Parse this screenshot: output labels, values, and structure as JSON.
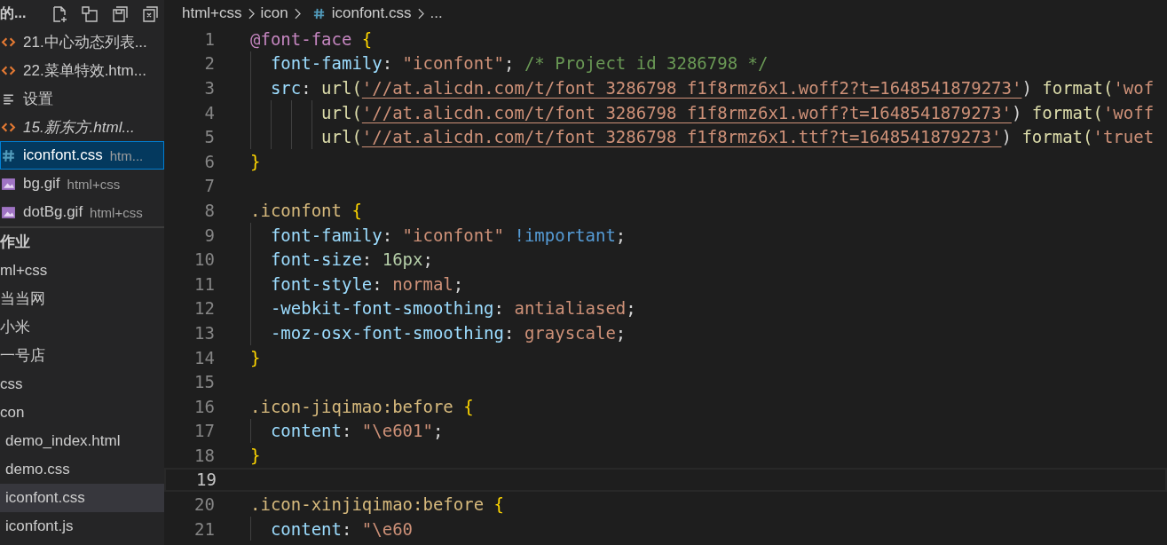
{
  "sidebar": {
    "open_editors": {
      "title": "的...",
      "items": [
        {
          "kind": "html",
          "label": "21.中心动态列表...",
          "italic": false,
          "selected": false
        },
        {
          "kind": "html",
          "label": "22.菜单特效.htm...",
          "italic": false,
          "selected": false
        },
        {
          "kind": "settings",
          "label": "设置",
          "italic": false,
          "selected": false
        },
        {
          "kind": "html",
          "label": "15.新东方.html...",
          "italic": true,
          "selected": false
        },
        {
          "kind": "css",
          "label": "iconfont.css",
          "description": "htm...",
          "italic": false,
          "selected": true
        },
        {
          "kind": "image",
          "label": "bg.gif",
          "description": "html+css",
          "italic": false,
          "selected": false
        },
        {
          "kind": "image",
          "label": "dotBg.gif",
          "description": "html+css",
          "italic": false,
          "selected": false
        }
      ]
    },
    "folder": {
      "title": "作业",
      "tree": [
        {
          "label": "ml+css",
          "selected": false
        },
        {
          "label": "当当网",
          "selected": false
        },
        {
          "label": "小米",
          "selected": false
        },
        {
          "label": "一号店",
          "selected": false
        },
        {
          "label": "css",
          "selected": false
        },
        {
          "label": "con",
          "selected": false,
          "children": [
            {
              "label": "demo_index.html",
              "selected": false
            },
            {
              "label": "demo.css",
              "selected": false
            },
            {
              "label": "iconfont.css",
              "selected": true
            },
            {
              "label": "iconfont.js",
              "selected": false
            }
          ]
        }
      ]
    }
  },
  "breadcrumb": [
    {
      "kind": "text",
      "label": "html+css"
    },
    {
      "kind": "text",
      "label": "icon"
    },
    {
      "kind": "css",
      "label": "iconfont.css"
    },
    {
      "kind": "text",
      "label": "..."
    }
  ],
  "editor": {
    "lines": [
      {
        "number": "1",
        "current": false,
        "text": "@font-face {"
      },
      {
        "number": "2",
        "current": false,
        "text": "  font-family: \"iconfont\"; /* Project id 3286798 */"
      },
      {
        "number": "3",
        "current": false,
        "text": "  src: url('//at.alicdn.com/t/font_3286798_f1f8rmz6x1.woff2?t=1648541879273') format('wof"
      },
      {
        "number": "4",
        "current": false,
        "text": "       url('//at.alicdn.com/t/font_3286798_f1f8rmz6x1.woff?t=1648541879273') format('woff"
      },
      {
        "number": "5",
        "current": false,
        "text": "       url('//at.alicdn.com/t/font_3286798_f1f8rmz6x1.ttf?t=1648541879273') format('truet"
      },
      {
        "number": "6",
        "current": false,
        "text": "}"
      },
      {
        "number": "7",
        "current": false
      },
      {
        "number": "8",
        "current": false,
        "text": ".iconfont {"
      },
      {
        "number": "9",
        "current": false,
        "text": "  font-family: \"iconfont\" !important;"
      },
      {
        "number": "10",
        "current": false,
        "text": "  font-size: 16px;"
      },
      {
        "number": "11",
        "current": false,
        "text": "  font-style: normal;"
      },
      {
        "number": "12",
        "current": false,
        "text": "  -webkit-font-smoothing: antialiased;"
      },
      {
        "number": "13",
        "current": false,
        "text": "  -moz-osx-font-smoothing: grayscale;"
      },
      {
        "number": "14",
        "current": false,
        "text": "}"
      },
      {
        "number": "15",
        "current": false
      },
      {
        "number": "16",
        "current": false,
        "text": ".icon-jiqimao:before {"
      },
      {
        "number": "17",
        "current": false,
        "text": "  content: \"\\e601\";"
      },
      {
        "number": "18",
        "current": false,
        "text": "}"
      },
      {
        "number": "19",
        "current": true
      },
      {
        "number": "20",
        "current": false,
        "text": ".icon-xinjiqimao:before {"
      },
      {
        "number": "21",
        "current": false,
        "text": "  content: \"\\e60"
      }
    ]
  }
}
